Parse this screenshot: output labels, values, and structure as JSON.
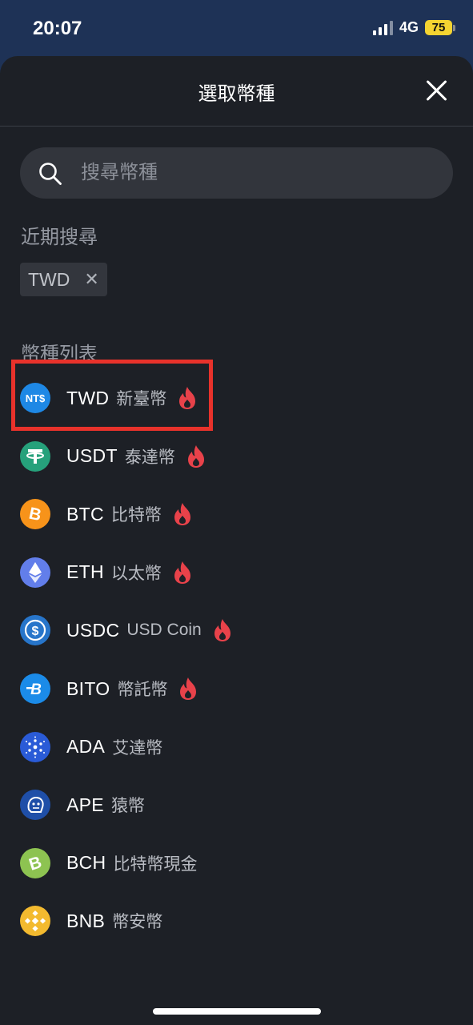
{
  "status_bar": {
    "time": "20:07",
    "network": "4G",
    "battery": "75"
  },
  "sheet": {
    "title": "選取幣種",
    "search": {
      "placeholder": "搜尋幣種",
      "value": ""
    },
    "recent_label": "近期搜尋",
    "recent_items": [
      {
        "label": "TWD"
      }
    ],
    "list_label": "幣種列表",
    "coins": [
      {
        "symbol": "TWD",
        "name": "新臺幣",
        "hot": true,
        "icon": "nt-dollar-icon",
        "color": "#1e88e5"
      },
      {
        "symbol": "USDT",
        "name": "泰達幣",
        "hot": true,
        "icon": "tether-icon",
        "color": "#26a17b"
      },
      {
        "symbol": "BTC",
        "name": "比特幣",
        "hot": true,
        "icon": "bitcoin-icon",
        "color": "#f7931a"
      },
      {
        "symbol": "ETH",
        "name": "以太幣",
        "hot": true,
        "icon": "ethereum-icon",
        "color": "#627eea"
      },
      {
        "symbol": "USDC",
        "name": "USD Coin",
        "hot": true,
        "icon": "usdc-icon",
        "color": "#2775ca"
      },
      {
        "symbol": "BITO",
        "name": "幣託幣",
        "hot": true,
        "icon": "bito-icon",
        "color": "#1b8be8"
      },
      {
        "symbol": "ADA",
        "name": "艾達幣",
        "hot": false,
        "icon": "cardano-icon",
        "color": "#2a5bd7"
      },
      {
        "symbol": "APE",
        "name": "猿幣",
        "hot": false,
        "icon": "apecoin-icon",
        "color": "#1f4fa8"
      },
      {
        "symbol": "BCH",
        "name": "比特幣現金",
        "hot": false,
        "icon": "bitcoin-cash-icon",
        "color": "#8dc351"
      },
      {
        "symbol": "BNB",
        "name": "幣安幣",
        "hot": false,
        "icon": "binance-icon",
        "color": "#f3ba2f"
      }
    ],
    "hot_color": "#e8424a",
    "highlight_color": "#e8322b"
  }
}
